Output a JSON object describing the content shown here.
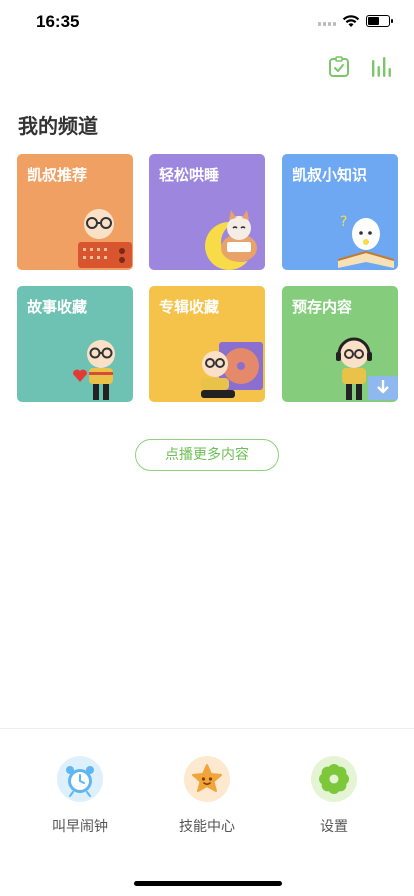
{
  "status_bar": {
    "time": "16:35"
  },
  "header": {
    "icons": [
      "check-icon",
      "bars-icon"
    ],
    "accent_color": "#7cc66a"
  },
  "section": {
    "title": "我的频道"
  },
  "cards": [
    {
      "label": "凯叔推荐",
      "color": "#f0a063",
      "illustration": "old-man-with-radio"
    },
    {
      "label": "轻松哄睡",
      "color": "#9d86de",
      "illustration": "cat-on-moon"
    },
    {
      "label": "凯叔小知识",
      "color": "#6ea8f3",
      "illustration": "egg-with-book"
    },
    {
      "label": "故事收藏",
      "color": "#6dc2b4",
      "illustration": "old-man-with-heart"
    },
    {
      "label": "专辑收藏",
      "color": "#f5c24a",
      "illustration": "old-man-with-record"
    },
    {
      "label": "预存内容",
      "color": "#85cd7c",
      "illustration": "old-man-with-headphones"
    }
  ],
  "more_button": {
    "label": "点播更多内容"
  },
  "tabbar": [
    {
      "label": "叫早闹钟",
      "icon": "alarm-clock-icon",
      "color": "#5fb6f2"
    },
    {
      "label": "技能中心",
      "icon": "star-icon",
      "color": "#f2a33a"
    },
    {
      "label": "设置",
      "icon": "gear-icon",
      "color": "#7cc83a"
    }
  ]
}
